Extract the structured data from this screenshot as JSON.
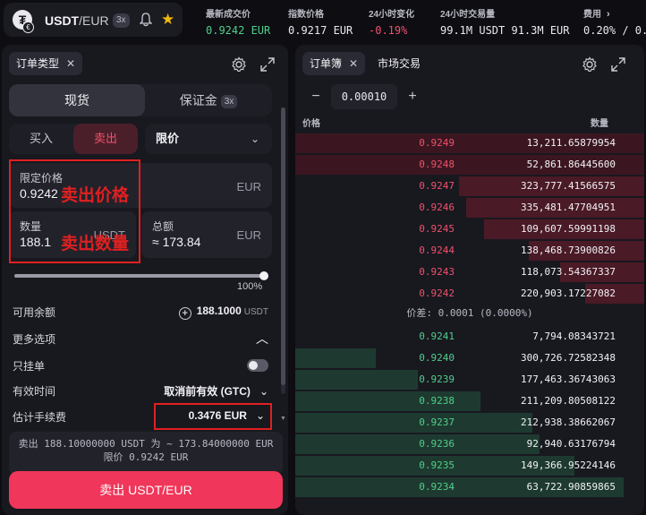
{
  "header": {
    "base": "USDT",
    "quote": "/EUR",
    "leverage": "3x",
    "stats": [
      {
        "label": "最新成交价",
        "value": "0.9242 EUR",
        "color": "green"
      },
      {
        "label": "指数价格",
        "value": "0.9217 EUR",
        "color": "white"
      },
      {
        "label": "24小时变化",
        "value": "-0.19%",
        "color": "red"
      },
      {
        "label": "24小时交易量",
        "value": "99.1M USDT  91.3M EUR",
        "color": "white"
      },
      {
        "label": "费用",
        "value": "0.20% / 0.",
        "color": "white"
      }
    ]
  },
  "order_panel": {
    "tab_label": "订单类型",
    "market_type_spot": "现货",
    "market_type_margin": "保证金",
    "margin_leverage": "3x",
    "buy_label": "买入",
    "sell_label": "卖出",
    "order_type": "限价",
    "price_field": {
      "label": "限定价格",
      "value": "0.9242",
      "currency": "EUR"
    },
    "qty_field": {
      "label": "数量",
      "value": "188.1",
      "currency": "USDT"
    },
    "total_field": {
      "label": "总额",
      "value": "≈ 173.84",
      "currency": "EUR"
    },
    "annotation_price": "卖出价格",
    "annotation_qty": "卖出数量",
    "slider_percent": "100%",
    "available_label": "可用余额",
    "available_value": "188.1000",
    "available_unit": "USDT",
    "more_options": "更多选项",
    "post_only": "只挂单",
    "tif_label": "有效时间",
    "tif_value": "取消前有效 (GTC)",
    "fee_label": "估计手续费",
    "fee_value": "0.3476 EUR",
    "summary_line1": "卖出 188.10000000 USDT 为 ~ 173.84000000 EUR",
    "summary_line2": "限价 0.9242 EUR",
    "submit_label": "卖出 USDT/EUR"
  },
  "orderbook": {
    "tab_book": "订单簿",
    "tab_trades": "市场交易",
    "step_value": "0.00010",
    "col_price": "价格",
    "col_qty": "数量",
    "spread": "价差: 0.0001 (0.0000%)",
    "asks": [
      {
        "price": "0.9249",
        "qty": "13,211.65879954",
        "depth": 1.0
      },
      {
        "price": "0.9248",
        "qty": "52,861.86445600",
        "depth": 1.0
      },
      {
        "price": "0.9247",
        "qty": "323,777.41566575",
        "depth": 0.53
      },
      {
        "price": "0.9246",
        "qty": "335,481.47704951",
        "depth": 0.51
      },
      {
        "price": "0.9245",
        "qty": "109,607.59991198",
        "depth": 0.46
      },
      {
        "price": "0.9244",
        "qty": "138,468.73900826",
        "depth": 0.33
      },
      {
        "price": "0.9243",
        "qty": "118,073.54367337",
        "depth": 0.24
      },
      {
        "price": "0.9242",
        "qty": "220,903.17227082",
        "depth": 0.17
      }
    ],
    "bids": [
      {
        "price": "0.9241",
        "qty": "7,794.08343721",
        "depth": 0.0
      },
      {
        "price": "0.9240",
        "qty": "300,726.72582348",
        "depth": 0.23
      },
      {
        "price": "0.9239",
        "qty": "177,463.36743063",
        "depth": 0.35
      },
      {
        "price": "0.9238",
        "qty": "211,209.80508122",
        "depth": 0.53
      },
      {
        "price": "0.9237",
        "qty": "212,938.38662067",
        "depth": 0.68
      },
      {
        "price": "0.9236",
        "qty": "92,940.63176794",
        "depth": 0.7
      },
      {
        "price": "0.9235",
        "qty": "149,366.95224146",
        "depth": 0.8
      },
      {
        "price": "0.9234",
        "qty": "63,722.90859865",
        "depth": 0.94
      }
    ]
  },
  "colors": {
    "ask_bar": "#4a1a26",
    "ask_bar_full": "#3b1620",
    "bid_bar": "#1e3a30",
    "sell_accent": "#f0365a",
    "annotation": "#e02020"
  }
}
